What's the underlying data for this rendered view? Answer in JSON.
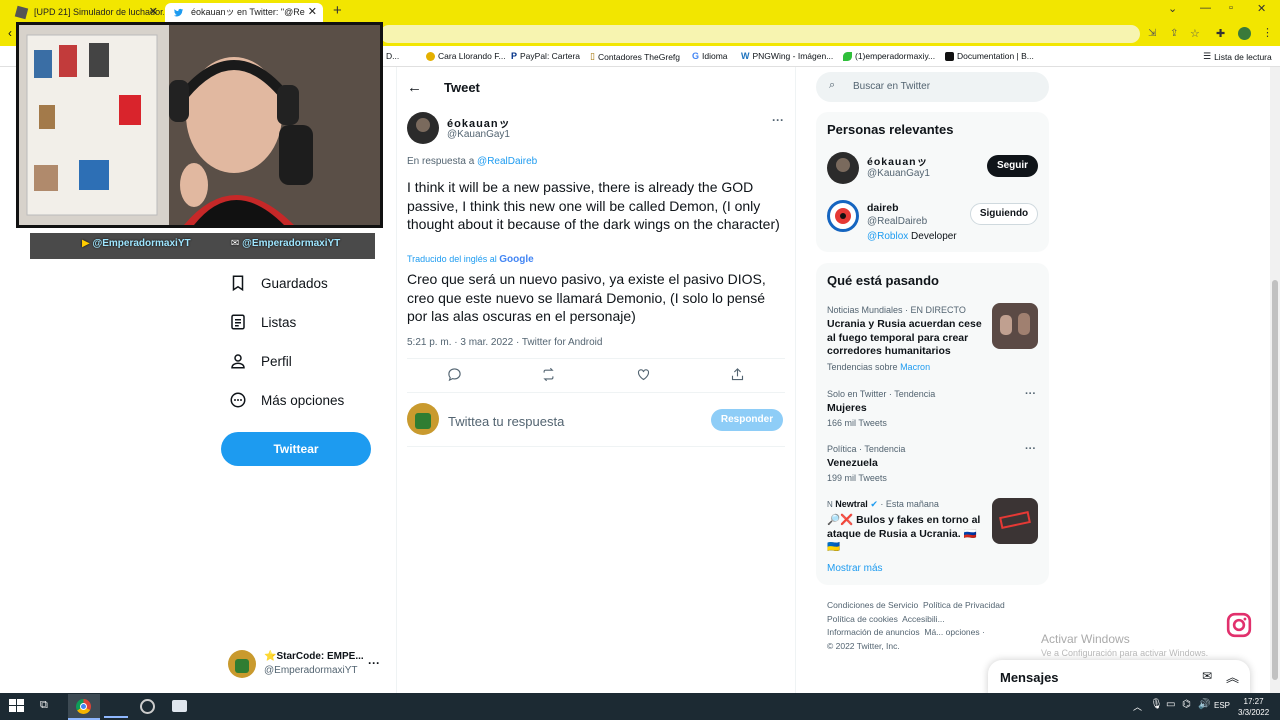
{
  "browser": {
    "tabs": [
      {
        "title": "[UPD 21] Simulador de luchador...",
        "active": false
      },
      {
        "title": "éokauanッ en Twitter: \"@Re",
        "active": true
      }
    ],
    "bookmarks": [
      {
        "label": "D..."
      },
      {
        "label": "Cara Llorando F..."
      },
      {
        "label": "PayPal: Cartera"
      },
      {
        "label": "Contadores TheGrefg"
      },
      {
        "label": "Idioma"
      },
      {
        "label": "PNGWing - Imágen..."
      },
      {
        "label": "(1)emperadormaxiy..."
      },
      {
        "label": "Documentation | B..."
      },
      {
        "label": "Lista de lectura"
      }
    ]
  },
  "overlay": {
    "handle1": "@EmperadormaxiYT",
    "handle2": "@EmperadormaxiYT"
  },
  "nav": {
    "items": [
      {
        "label": "Guardados",
        "icon": "bookmark-icon"
      },
      {
        "label": "Listas",
        "icon": "list-icon"
      },
      {
        "label": "Perfil",
        "icon": "person-icon"
      },
      {
        "label": "Más opciones",
        "icon": "more-circle-icon"
      }
    ],
    "tweet_button": "Twittear",
    "account": {
      "name": "⭐StarCode: EMPE...",
      "handle": "@EmperadormaxiYT"
    }
  },
  "tweet": {
    "header": "Tweet",
    "author_name": "éokauanッ",
    "author_handle": "@KauanGay1",
    "reply_prefix": "En respuesta a",
    "reply_to": "@RealDaireb",
    "text_en": "I think it will be a new passive, there is already the GOD passive, I think this new one will be called Demon, (I only thought about it because of the dark wings on the character)",
    "translated_label": "Traducido del inglés al",
    "translator": "Google",
    "text_es": "Creo que será un nuevo pasivo, ya existe el pasivo DIOS, creo que este nuevo se llamará Demonio, (I solo lo pensé por las alas oscuras en el personaje)",
    "meta": "5:21 p. m. · 3 mar. 2022 · Twitter for Android",
    "reply_placeholder": "Twittea tu respuesta",
    "reply_button": "Responder"
  },
  "right": {
    "search_placeholder": "Buscar en Twitter",
    "relevant_title": "Personas relevantes",
    "people": [
      {
        "name": "éokauanッ",
        "handle": "@KauanGay1",
        "button": "Seguir",
        "bio_link": "",
        "bio": ""
      },
      {
        "name": "daireb",
        "handle": "@RealDaireb",
        "button": "Siguiendo",
        "bio_link": "@Roblox",
        "bio": " Developer"
      }
    ],
    "trending_title": "Qué está pasando",
    "trends": [
      {
        "context": "Noticias Mundiales · EN DIRECTO",
        "title": "Ucrania y Rusia acuerdan cese al fuego temporal para crear corredores humanitarios",
        "extra_prefix": "Tendencias sobre",
        "extra_link": "Macron"
      },
      {
        "context": "Solo en Twitter · Tendencia",
        "title": "Mujeres",
        "count": "166 mil Tweets"
      },
      {
        "context": "Política · Tendencia",
        "title": "Venezuela",
        "count": "199 mil Tweets"
      },
      {
        "source": "Newtral",
        "time": "· Esta mañana",
        "title": "🔎❌ Bulos y fakes en torno al ataque de Rusia a Ucrania. 🇷🇺🇺🇦"
      }
    ],
    "show_more": "Mostrar más",
    "footer": {
      "l1a": "Condiciones de Servicio",
      "l1b": "Política de Privacidad",
      "l2a": "Política de cookies",
      "l2b": "Accesibili...",
      "l3a": "Información de anuncios",
      "l3b": "Má... opciones ·",
      "copyright": "© 2022 Twitter, Inc."
    }
  },
  "messages": "Mensajes",
  "activate": {
    "title": "Activar Windows",
    "subtitle": "Ve a Configuración para activar Windows."
  },
  "taskbar": {
    "lang": "ESP",
    "time": "17:27",
    "date": "3/3/2022"
  },
  "colors": {
    "twitter_blue": "#1d9bf0",
    "chrome_yellow": "#f2e600"
  }
}
